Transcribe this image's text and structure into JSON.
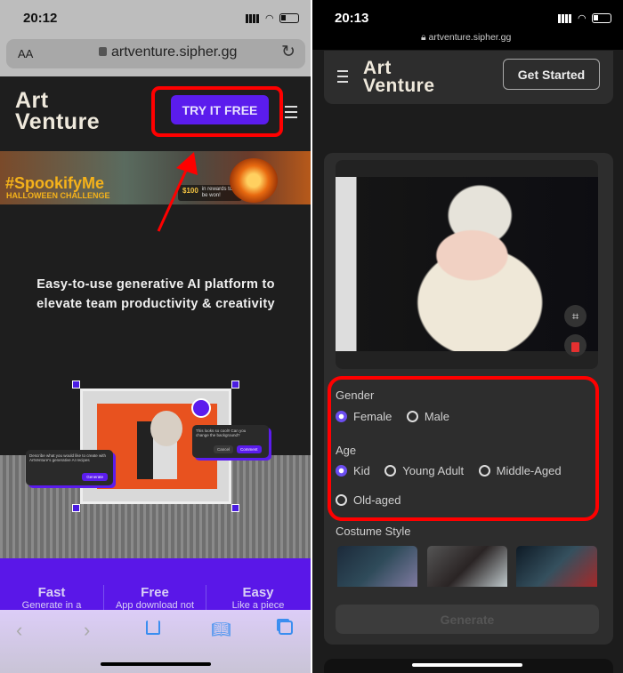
{
  "left": {
    "status": {
      "time": "20:12"
    },
    "url_bar": {
      "text_size": "AA",
      "url": "artventure.sipher.gg"
    },
    "header": {
      "logo_line1": "Art",
      "logo_line2": "Venture",
      "cta": "TRY IT FREE"
    },
    "banner": {
      "hashtag": "#SpookifyMe",
      "subtitle": "HALLOWEEN CHALLENGE",
      "reward": "$100",
      "reward_note": "in rewards to be won!"
    },
    "hero": {
      "tagline": "Easy-to-use generative AI platform to elevate team productivity & creativity"
    },
    "illustration": {
      "prompt_text": "Describe what you would like to create with ArtVenture's generative AI recipes",
      "generate": "Generate",
      "comment_text": "This looks so cool!! Can you change the background?",
      "cancel": "Cancel",
      "comment": "Comment"
    },
    "features": [
      {
        "title": "Fast",
        "desc": "Generate in a"
      },
      {
        "title": "Free",
        "desc": "App download not"
      },
      {
        "title": "Easy",
        "desc": "Like a piece"
      }
    ],
    "toolbar": {
      "icons": [
        "back-icon",
        "forward-icon",
        "share-icon",
        "bookmarks-icon",
        "tabs-icon"
      ]
    }
  },
  "right": {
    "status": {
      "time": "20:13",
      "url": "artventure.sipher.gg"
    },
    "header": {
      "logo_line1": "Art",
      "logo_line2": "Venture",
      "cta": "Get Started"
    },
    "form": {
      "gender_label": "Gender",
      "gender_options": [
        {
          "label": "Female",
          "selected": true
        },
        {
          "label": "Male",
          "selected": false
        }
      ],
      "age_label": "Age",
      "age_options": [
        {
          "label": "Kid",
          "selected": true
        },
        {
          "label": "Young Adult",
          "selected": false
        },
        {
          "label": "Middle-Aged",
          "selected": false
        },
        {
          "label": "Old-aged",
          "selected": false
        }
      ],
      "costume_label": "Costume Style",
      "generate": "Generate"
    }
  },
  "colors": {
    "brand_purple": "#5b1ced",
    "highlight_red": "#ff0000",
    "radio_selected": "#6b4df0"
  }
}
